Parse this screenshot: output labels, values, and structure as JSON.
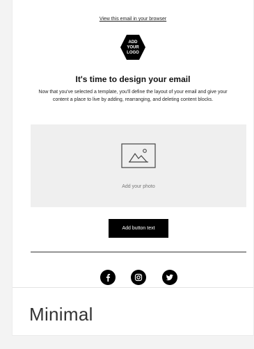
{
  "email": {
    "browser_link": "View this email in your browser",
    "logo": {
      "line1": "ADD",
      "line2": "YOUR",
      "line3": "LOGO"
    },
    "headline": "It's time to design your email",
    "body": "Now that you've selected a template, you'll define the layout of your email and give your content a place to live by adding, rearranging, and deleting content blocks.",
    "photo_label": "Add your photo",
    "button_text": "Add button text",
    "social_icons": [
      "facebook-icon",
      "instagram-icon",
      "twitter-icon"
    ]
  },
  "template": {
    "name": "Minimal"
  },
  "colors": {
    "page_background": "#f3f3f3",
    "card_background": "#ffffff",
    "button_background": "#000000",
    "photo_placeholder": "#efefef"
  }
}
